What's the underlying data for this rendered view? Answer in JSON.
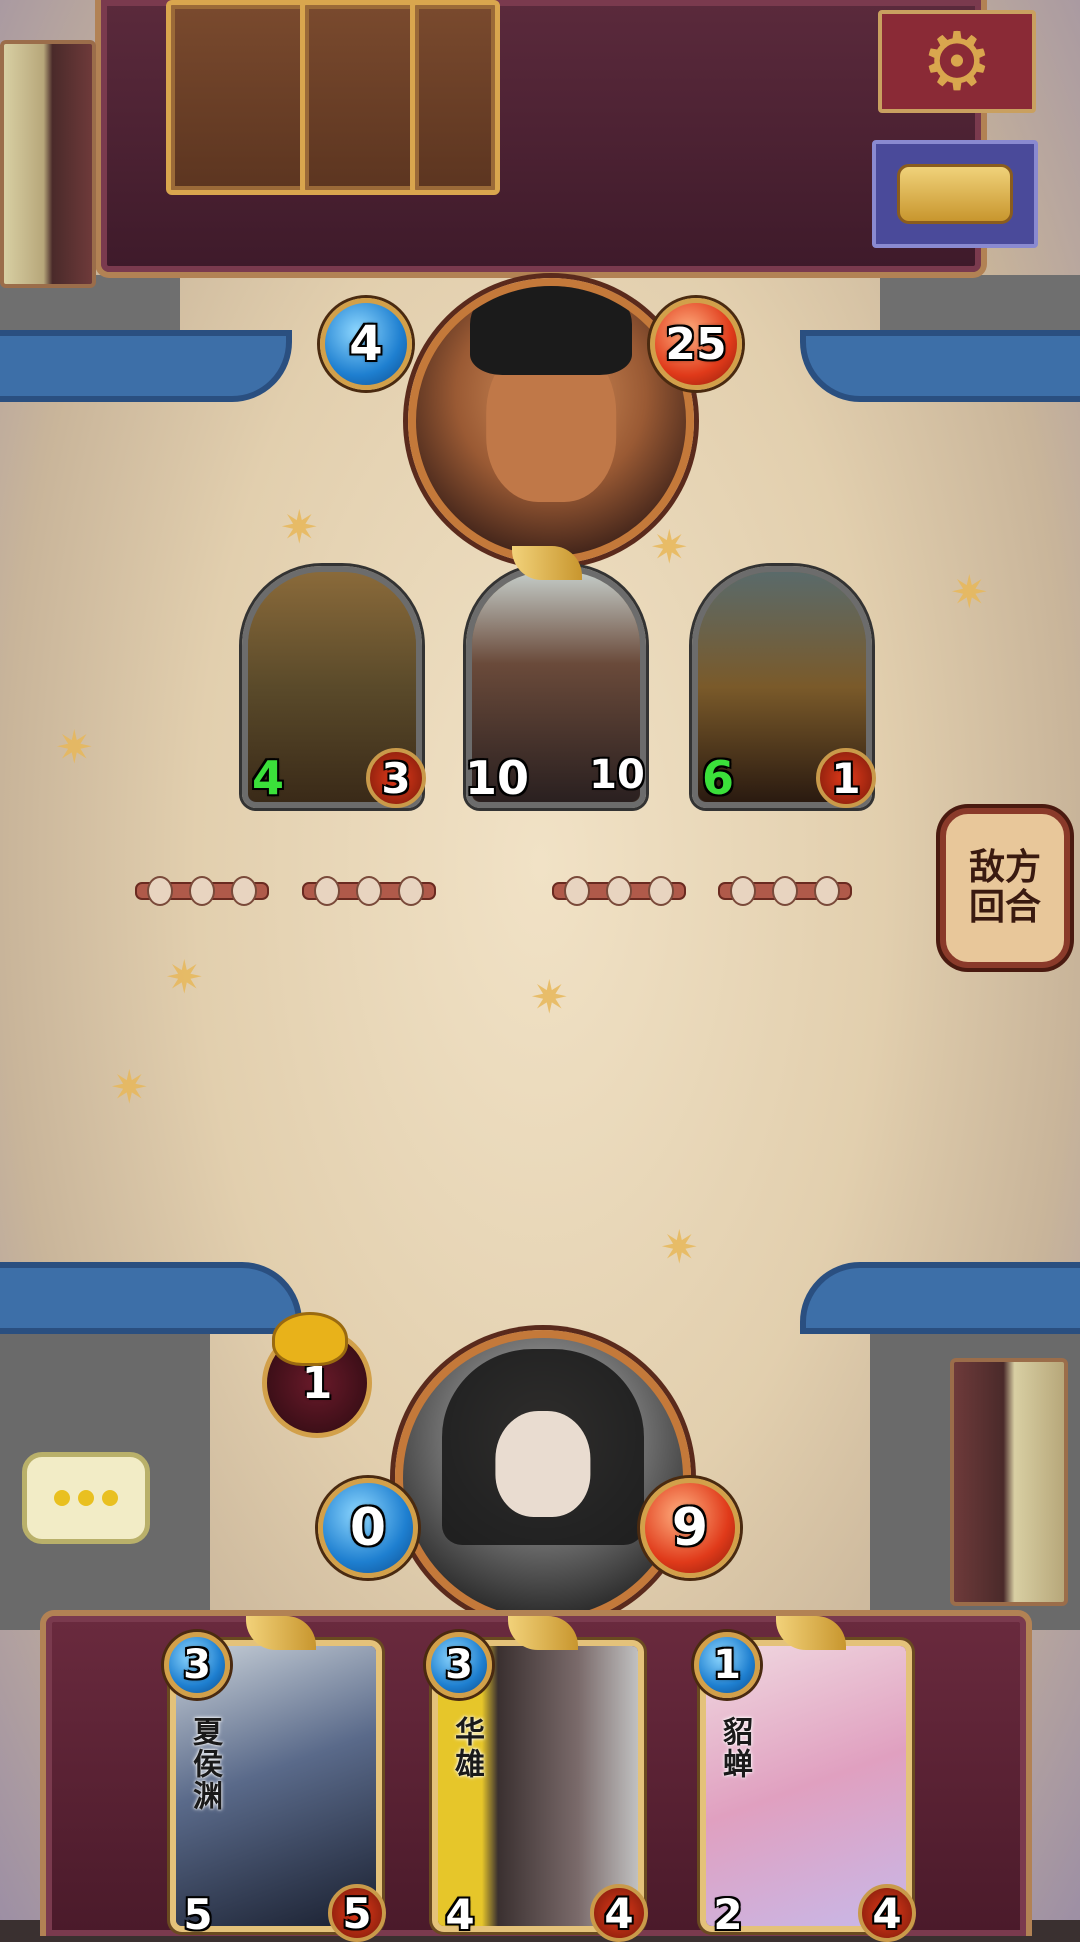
{
  "enemy": {
    "mana": "4",
    "health": "25",
    "minions": [
      {
        "attack": "4",
        "health": "3",
        "attack_color": "green"
      },
      {
        "attack": "10",
        "health": "10",
        "attack_color": "white"
      },
      {
        "attack": "6",
        "health": "1",
        "attack_color": "green"
      }
    ]
  },
  "turn_badge": {
    "text": "敌方回合"
  },
  "player": {
    "mana": "0",
    "health": "9",
    "gold": "1"
  },
  "hand": [
    {
      "name": "夏侯渊",
      "cost": "3",
      "attack": "5",
      "health": "5"
    },
    {
      "name": "华雄",
      "cost": "3",
      "attack": "4",
      "health": "4"
    },
    {
      "name": "貂蝉",
      "cost": "1",
      "attack": "2",
      "health": "4"
    }
  ],
  "icons": {
    "settings": "gear-icon",
    "log": "scroll-icon",
    "chat": "chat-bubble-icon",
    "gold": "gold-pouch-icon"
  },
  "colors": {
    "mana_blue": "#1e7fd0",
    "health_red": "#e03a1a",
    "panel_maroon": "#5b2a3c",
    "gold_trim": "#d2a04a"
  }
}
